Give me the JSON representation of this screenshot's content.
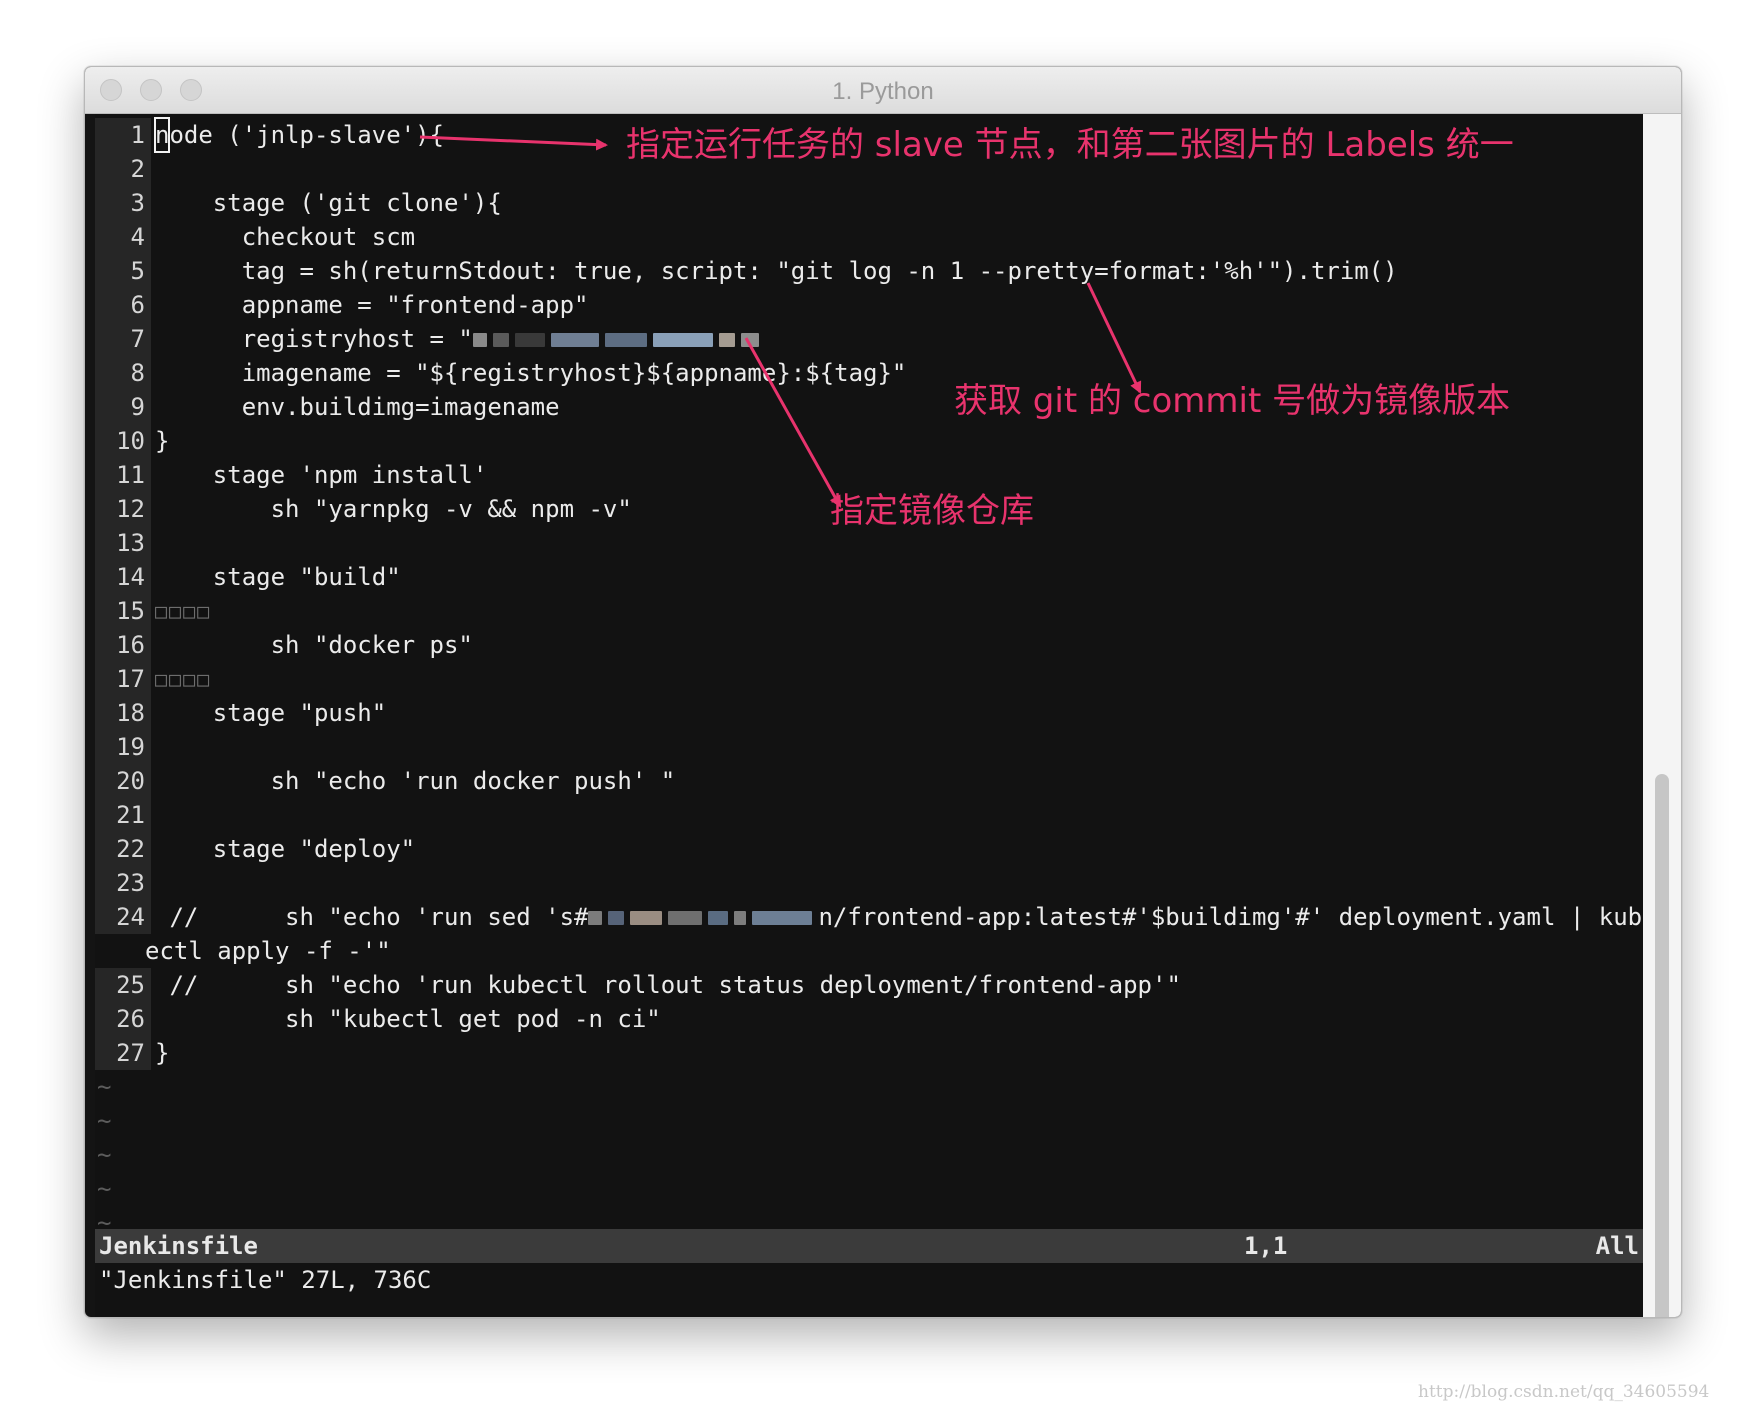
{
  "window": {
    "title": "1. Python"
  },
  "editor": {
    "lines": [
      {
        "n": "1",
        "text": "ode ('jnlp-slave'){",
        "cursor_char": "n"
      },
      {
        "n": "2",
        "text": ""
      },
      {
        "n": "3",
        "text": "    stage ('git clone'){"
      },
      {
        "n": "4",
        "text": "      checkout scm"
      },
      {
        "n": "5",
        "text": "      tag = sh(returnStdout: true, script: \"git log -n 1 --pretty=format:'%h'\").trim()"
      },
      {
        "n": "6",
        "text": "      appname = \"frontend-app\""
      },
      {
        "n": "7",
        "text": "      registryhost = \""
      },
      {
        "n": "8",
        "text": "      imagename = \"${registryhost}${appname}:${tag}\""
      },
      {
        "n": "9",
        "text": "      env.buildimg=imagename"
      },
      {
        "n": "10",
        "text": "}"
      },
      {
        "n": "11",
        "text": "    stage 'npm install'"
      },
      {
        "n": "12",
        "text": "        sh \"yarnpkg -v && npm -v\""
      },
      {
        "n": "13",
        "text": ""
      },
      {
        "n": "14",
        "text": "    stage \"build\""
      },
      {
        "n": "15",
        "text": "□□□□"
      },
      {
        "n": "16",
        "text": "        sh \"docker ps\""
      },
      {
        "n": "17",
        "text": "□□□□"
      },
      {
        "n": "18",
        "text": "    stage \"push\""
      },
      {
        "n": "19",
        "text": ""
      },
      {
        "n": "20",
        "text": "        sh \"echo 'run docker push' \""
      },
      {
        "n": "21",
        "text": ""
      },
      {
        "n": "22",
        "text": "    stage \"deploy\""
      },
      {
        "n": "23",
        "text": ""
      },
      {
        "n": "24",
        "text": " //      sh \"echo 'run sed 's#",
        "text_after": "n/frontend-app:latest#'$buildimg'#' deployment.yaml | kub"
      },
      {
        "n": "",
        "text": "ectl apply -f -'\""
      },
      {
        "n": "25",
        "text": " //      sh \"echo 'run kubectl rollout status deployment/frontend-app'\""
      },
      {
        "n": "26",
        "text": "         sh \"kubectl get pod -n ci\""
      },
      {
        "n": "27",
        "text": "}"
      }
    ],
    "tildes": [
      "~",
      "~",
      "~",
      "~",
      "~"
    ]
  },
  "status": {
    "filename": "Jenkinsfile",
    "position": "1,1",
    "scroll": "All"
  },
  "command_line": "\"Jenkinsfile\" 27L, 736C",
  "annotations": {
    "slave": "指定运行任务的 slave 节点，和第二张图片的 Labels 统一",
    "commit": "获取 git 的 commit 号做为镜像版本",
    "registry": "指定镜像仓库"
  },
  "watermark": "http://blog.csdn.net/qq_34605594",
  "colors": {
    "annotation": "#e8336d",
    "editor_bg": "#121212",
    "gutter_bg": "#262626",
    "status_bg": "#3b3b3b"
  }
}
